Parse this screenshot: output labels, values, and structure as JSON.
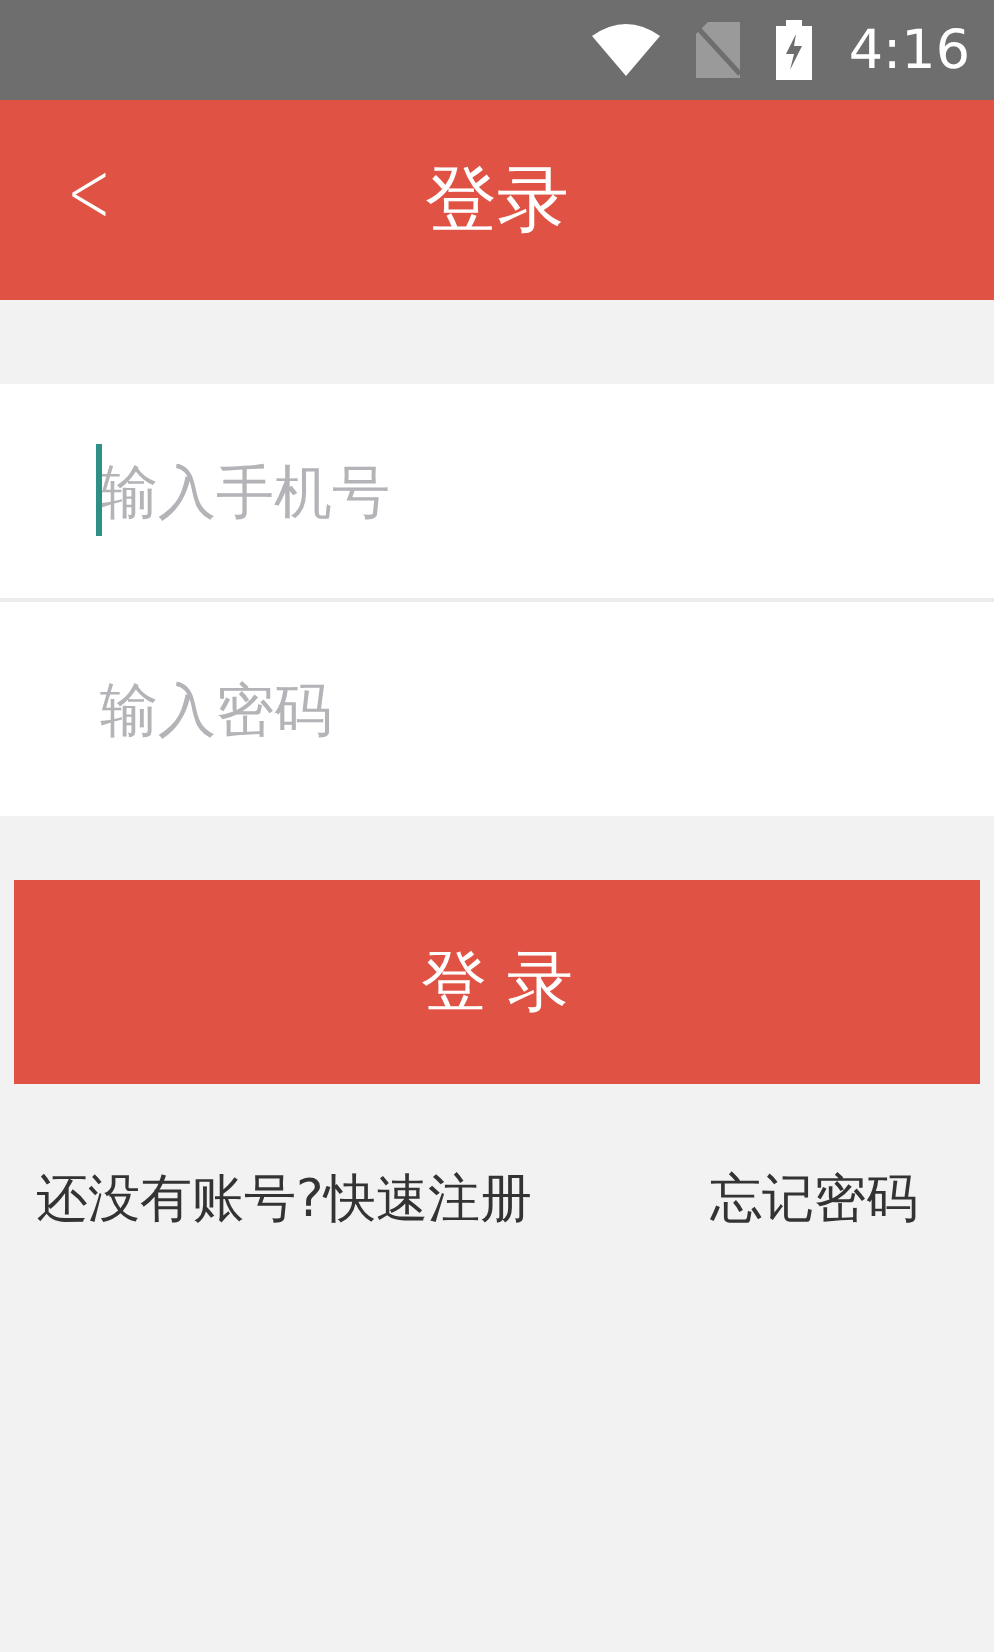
{
  "status_bar": {
    "time": "4:16"
  },
  "header": {
    "back": "<",
    "title": "登录"
  },
  "fields": [
    {
      "placeholder": "输入手机号",
      "focused": true
    },
    {
      "placeholder": "输入密码",
      "focused": false
    }
  ],
  "login_button": "登 录",
  "links": [
    {
      "label": "还没有账号?快速注册"
    },
    {
      "label": "忘记密码"
    }
  ]
}
